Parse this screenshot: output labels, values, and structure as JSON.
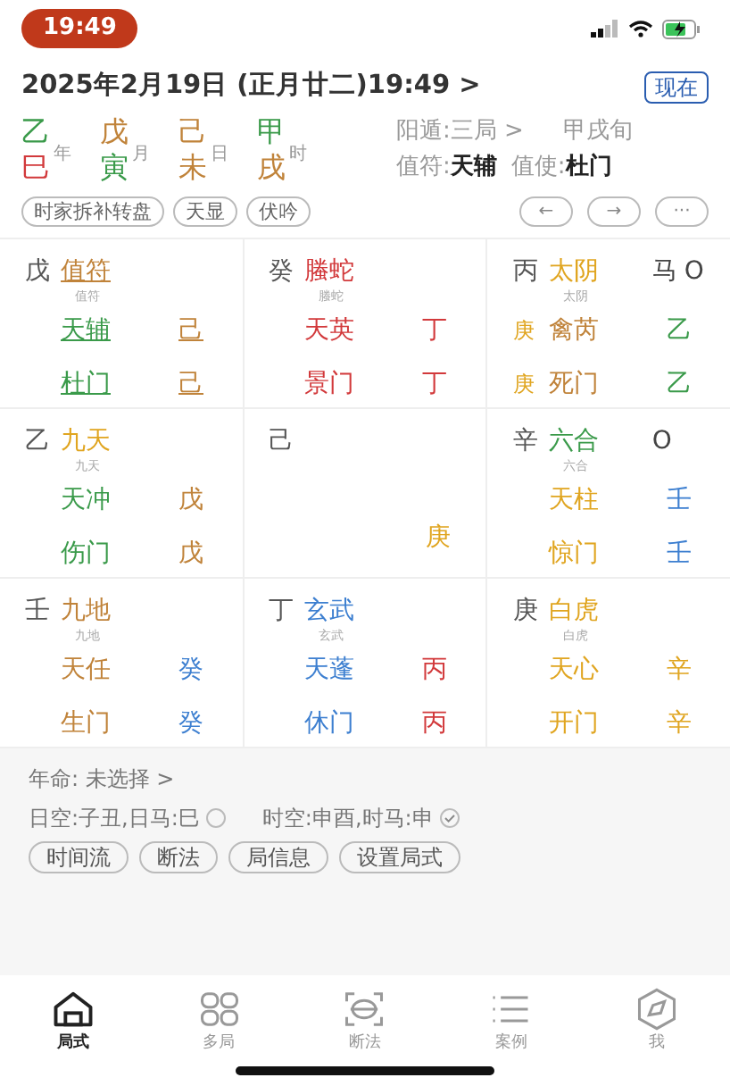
{
  "status_bar": {
    "time": "19:49"
  },
  "header": {
    "date": "2025年2月19日 (正月廿二)19:49 >",
    "now_button": "现在"
  },
  "pillars": [
    {
      "stem": {
        "text": "乙",
        "color": "#3a9a4a"
      },
      "branch": {
        "text": "巳",
        "color": "#d2393b"
      },
      "label": "年"
    },
    {
      "stem": {
        "text": "戊",
        "color": "#c0833a"
      },
      "branch": {
        "text": "寅",
        "color": "#3a9a4a"
      },
      "label": "月"
    },
    {
      "stem": {
        "text": "己",
        "color": "#c0833a"
      },
      "branch": {
        "text": "未",
        "color": "#c0833a"
      },
      "label": "日"
    },
    {
      "stem": {
        "text": "甲",
        "color": "#3a9a4a"
      },
      "branch": {
        "text": "戌",
        "color": "#c0833a"
      },
      "label": "时"
    }
  ],
  "info": {
    "dun": "阳遁:三局 >",
    "xun": "甲戌旬",
    "zhifu_label": "值符:",
    "zhifu": "天辅",
    "zhishi_label": "值使:",
    "zhishi": "杜门"
  },
  "chips": [
    "时家拆补转盘",
    "天显",
    "伏吟"
  ],
  "nav_buttons": [
    "←",
    "→",
    "···"
  ],
  "palaces": [
    {
      "kind": "outer",
      "stem": "戊",
      "god": {
        "text": "值符",
        "sub": "值符",
        "color": "#c0833a",
        "underlined": true
      },
      "rows": [
        {
          "name": {
            "text": "天辅",
            "color": "#3a9a4a",
            "underlined": true
          },
          "stem": {
            "text": "己",
            "color": "#c0833a",
            "underlined": true
          }
        },
        {
          "name": {
            "text": "杜门",
            "color": "#3a9a4a",
            "underlined": true
          },
          "stem": {
            "text": "己",
            "color": "#c0833a",
            "underlined": true
          }
        }
      ]
    },
    {
      "kind": "outer",
      "stem": "癸",
      "god": {
        "text": "螣蛇",
        "sub": "螣蛇",
        "color": "#d2393b"
      },
      "rows": [
        {
          "name": {
            "text": "天英",
            "color": "#d2393b"
          },
          "stem": {
            "text": "丁",
            "color": "#d2393b"
          }
        },
        {
          "name": {
            "text": "景门",
            "color": "#d2393b"
          },
          "stem": {
            "text": "丁",
            "color": "#d2393b"
          }
        }
      ]
    },
    {
      "kind": "outer",
      "stem": "丙",
      "god": {
        "text": "太阴",
        "sub": "太阴",
        "color": "#e0a520"
      },
      "marks": [
        "马",
        "O"
      ],
      "rows": [
        {
          "prefix": {
            "text": "庚",
            "color": "#e0a520"
          },
          "name": {
            "text": "禽芮",
            "color": "#c0833a"
          },
          "stem": {
            "text": "乙",
            "color": "#3a9a4a"
          }
        },
        {
          "prefix": {
            "text": "庚",
            "color": "#e0a520"
          },
          "name": {
            "text": "死门",
            "color": "#c0833a"
          },
          "stem": {
            "text": "乙",
            "color": "#3a9a4a"
          }
        }
      ]
    },
    {
      "kind": "outer",
      "stem": "乙",
      "god": {
        "text": "九天",
        "sub": "九天",
        "color": "#e0a520"
      },
      "rows": [
        {
          "name": {
            "text": "天冲",
            "color": "#3a9a4a"
          },
          "stem": {
            "text": "戊",
            "color": "#c0833a"
          }
        },
        {
          "name": {
            "text": "伤门",
            "color": "#3a9a4a"
          },
          "stem": {
            "text": "戊",
            "color": "#c0833a"
          }
        }
      ]
    },
    {
      "kind": "center",
      "stem": "己",
      "bottom": {
        "text": "庚",
        "color": "#e0a520"
      }
    },
    {
      "kind": "outer",
      "stem": "辛",
      "god": {
        "text": "六合",
        "sub": "六合",
        "color": "#3a9a4a"
      },
      "marks": [
        "O"
      ],
      "rows": [
        {
          "name": {
            "text": "天柱",
            "color": "#e0a520"
          },
          "stem": {
            "text": "壬",
            "color": "#3d7fd0"
          }
        },
        {
          "name": {
            "text": "惊门",
            "color": "#e0a520"
          },
          "stem": {
            "text": "壬",
            "color": "#3d7fd0"
          }
        }
      ]
    },
    {
      "kind": "outer",
      "stem": "壬",
      "god": {
        "text": "九地",
        "sub": "九地",
        "color": "#c0833a"
      },
      "rows": [
        {
          "name": {
            "text": "天任",
            "color": "#c0833a"
          },
          "stem": {
            "text": "癸",
            "color": "#3d7fd0"
          }
        },
        {
          "name": {
            "text": "生门",
            "color": "#c0833a"
          },
          "stem": {
            "text": "癸",
            "color": "#3d7fd0"
          }
        }
      ]
    },
    {
      "kind": "outer",
      "stem": "丁",
      "god": {
        "text": "玄武",
        "sub": "玄武",
        "color": "#3d7fd0"
      },
      "rows": [
        {
          "name": {
            "text": "天蓬",
            "color": "#3d7fd0"
          },
          "stem": {
            "text": "丙",
            "color": "#d2393b"
          }
        },
        {
          "name": {
            "text": "休门",
            "color": "#3d7fd0"
          },
          "stem": {
            "text": "丙",
            "color": "#d2393b"
          }
        }
      ]
    },
    {
      "kind": "outer",
      "stem": "庚",
      "god": {
        "text": "白虎",
        "sub": "白虎",
        "color": "#e0a520"
      },
      "rows": [
        {
          "name": {
            "text": "天心",
            "color": "#e0a520"
          },
          "stem": {
            "text": "辛",
            "color": "#e0a520"
          }
        },
        {
          "name": {
            "text": "开门",
            "color": "#e0a520"
          },
          "stem": {
            "text": "辛",
            "color": "#e0a520"
          }
        }
      ]
    }
  ],
  "nianming": "年命: 未选择 >",
  "kong": [
    {
      "text": "日空:子丑,日马:巳",
      "checked": false
    },
    {
      "text": "时空:申酉,时马:申",
      "checked": true
    }
  ],
  "actions": [
    "时间流",
    "断法",
    "局信息",
    "设置局式"
  ],
  "tabs": [
    {
      "label": "局式",
      "selected": true
    },
    {
      "label": "多局",
      "selected": false
    },
    {
      "label": "断法",
      "selected": false
    },
    {
      "label": "案例",
      "selected": false
    },
    {
      "label": "我",
      "selected": false
    }
  ]
}
